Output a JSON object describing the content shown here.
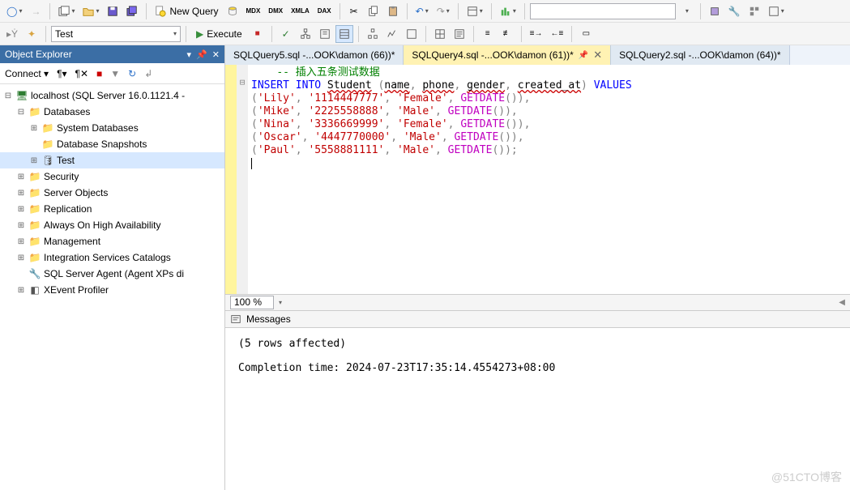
{
  "toolbar1": {
    "new_query": "New Query",
    "search_placeholder": ""
  },
  "toolbar2": {
    "db_selector": "Test",
    "execute": "Execute"
  },
  "object_explorer": {
    "title": "Object Explorer",
    "connect": "Connect",
    "root": "localhost (SQL Server 16.0.1121.4 -",
    "nodes": {
      "databases": "Databases",
      "system_db": "System Databases",
      "snapshots": "Database Snapshots",
      "test": "Test",
      "security": "Security",
      "server_objects": "Server Objects",
      "replication": "Replication",
      "always_on": "Always On High Availability",
      "management": "Management",
      "isc": "Integration Services Catalogs",
      "agent": "SQL Server Agent (Agent XPs di",
      "xevent": "XEvent Profiler"
    }
  },
  "tabs": [
    {
      "label": "SQLQuery5.sql -...OOK\\damon (66))*",
      "active": false,
      "pinned": false
    },
    {
      "label": "SQLQuery4.sql -...OOK\\damon (61))*",
      "active": true,
      "pinned": true
    },
    {
      "label": "SQLQuery2.sql -...OOK\\damon (64))*",
      "active": false,
      "pinned": false
    }
  ],
  "sql": {
    "comment_prefix": "--",
    "comment_text": " 插入五条测试数据",
    "insert_kw": "INSERT INTO",
    "table": "Student",
    "cols": [
      "name",
      "phone",
      "gender",
      "created_at"
    ],
    "values_kw": "VALUES",
    "func": "GETDATE",
    "rows": [
      [
        "'Lily'",
        "'1114447777'",
        "'Female'"
      ],
      [
        "'Mike'",
        "'2225558888'",
        "'Male'"
      ],
      [
        "'Nina'",
        "'3336669999'",
        "'Female'"
      ],
      [
        "'Oscar'",
        "'4447770000'",
        "'Male'"
      ],
      [
        "'Paul'",
        "'5558881111'",
        "'Male'"
      ]
    ]
  },
  "zoom": "100 %",
  "messages_tab": "Messages",
  "messages": {
    "rows_affected": "(5 rows affected)",
    "completion": "Completion time: 2024-07-23T17:35:14.4554273+08:00"
  },
  "watermark": "@51CTO博客"
}
